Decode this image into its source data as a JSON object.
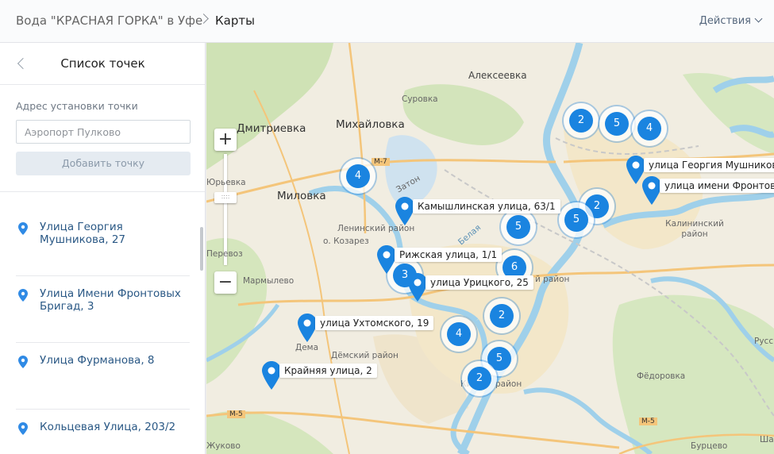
{
  "header": {
    "breadcrumb_root": "Вода \"КРАСНАЯ ГОРКА\" в Уфе",
    "breadcrumb_current": "Карты",
    "actions_label": "Действия"
  },
  "sidebar": {
    "title": "Список точек",
    "address_label": "Адрес установки точки",
    "address_placeholder": "Аэропорт Пулково",
    "add_button": "Добавить точку",
    "items": [
      {
        "label": "Улица Георгия Мушникова, 27"
      },
      {
        "label": "Улица Имени Фронтовых Бригад, 3"
      },
      {
        "label": "Улица Фурманова, 8"
      },
      {
        "label": "Кольцевая Улица, 203/2"
      }
    ]
  },
  "map": {
    "accent_color": "#1a84e0",
    "places": [
      {
        "text": "Алексеевка"
      },
      {
        "text": "Суровка"
      },
      {
        "text": "Дмитриевка"
      },
      {
        "text": "Михайловка"
      },
      {
        "text": "Миловка"
      },
      {
        "text": "Ленинский район"
      },
      {
        "text": "о. Козарез"
      },
      {
        "text": "Мармылево"
      },
      {
        "text": "Дема"
      },
      {
        "text": "Дёмский район"
      },
      {
        "text": "Калининский район"
      },
      {
        "text": "Фёдоровка"
      },
      {
        "text": "Жуково"
      },
      {
        "text": "Бурцево"
      },
      {
        "text": "Шамо"
      },
      {
        "text": "Русск"
      },
      {
        "text": "Кир"
      },
      {
        "text": "район"
      },
      {
        "text": "й район"
      },
      {
        "text": "Белая"
      },
      {
        "text": "Затон"
      },
      {
        "text": "М-7"
      },
      {
        "text": "М-5"
      },
      {
        "text": "М-5"
      },
      {
        "text": "Юрьевка"
      },
      {
        "text": "Перевоз"
      }
    ],
    "clusters": [
      "2",
      "5",
      "4",
      "4",
      "2",
      "5",
      "5",
      "6",
      "3",
      "2",
      "4",
      "5",
      "2"
    ],
    "markers": [
      {
        "label": "улица Георгия Мушникова"
      },
      {
        "label": "улица имени Фронтовы"
      },
      {
        "label": "Камышлинская улица, 63/1"
      },
      {
        "label": "Рижская улица, 1/1"
      },
      {
        "label": "улица Урицкого, 25"
      },
      {
        "label": "улица Ухтомского, 19"
      },
      {
        "label": "Крайняя улица, 2"
      }
    ],
    "zoom_in": "+",
    "zoom_out": "−"
  }
}
